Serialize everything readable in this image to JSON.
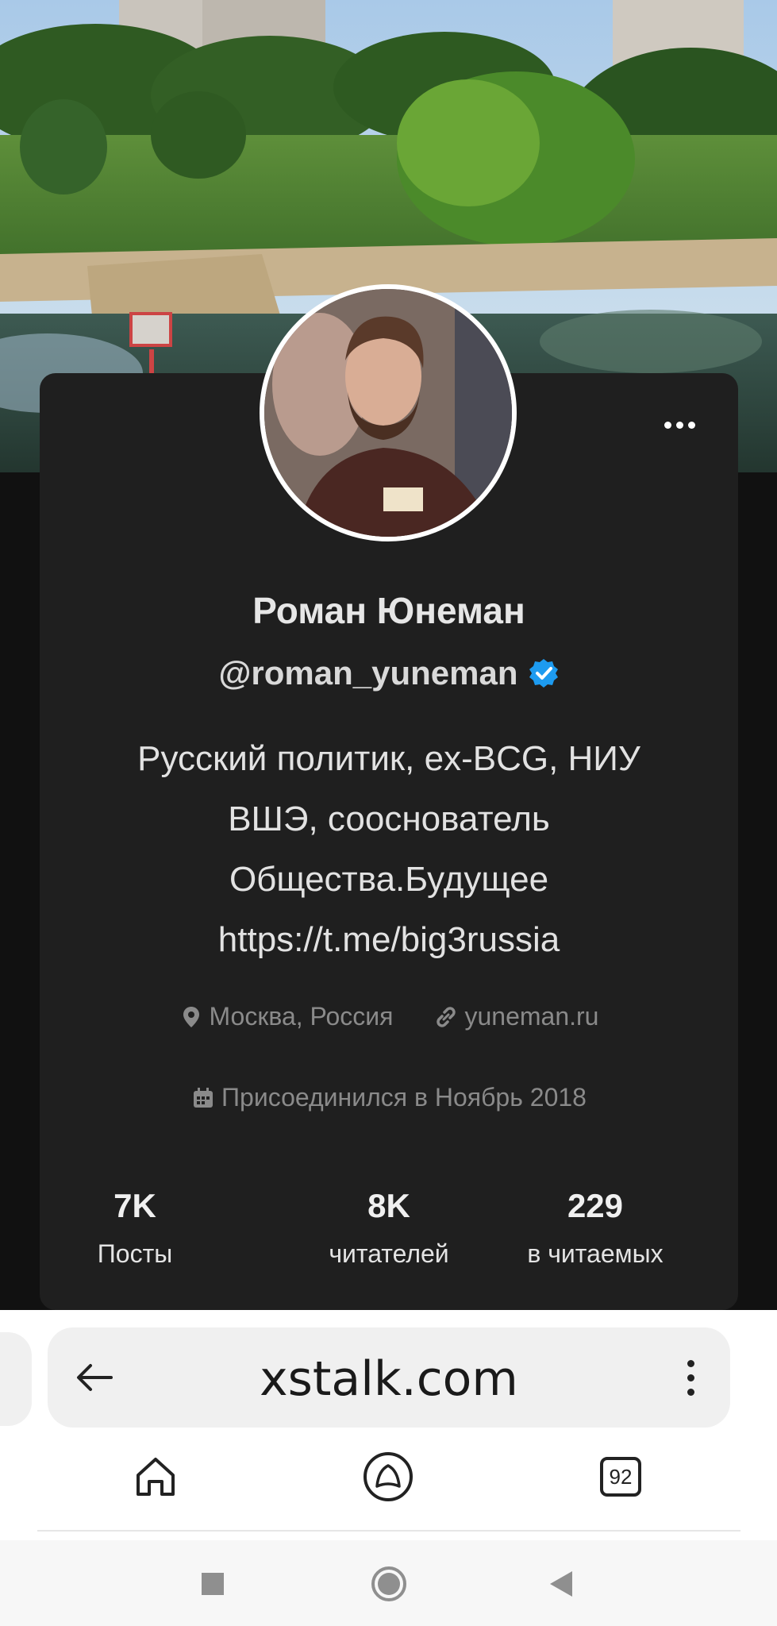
{
  "profile": {
    "name": "Роман Юнеман",
    "handle": "@roman_yuneman",
    "verified": true,
    "bio_lines": [
      "Русский политик, ex-BCG, НИУ",
      "ВШЭ, сооснователь",
      "Общества.Будущее",
      "https://t.me/big3russia"
    ],
    "location": "Москва, Россия",
    "website": "yuneman.ru",
    "joined": "Присоединился в Ноябрь 2018"
  },
  "stats": [
    {
      "value": "7K",
      "label": "Посты"
    },
    {
      "value": "8K",
      "label": "читателей"
    },
    {
      "value": "229",
      "label": "в читаемых"
    }
  ],
  "browser": {
    "url": "xstalk.com",
    "tabs_count": "92"
  },
  "colors": {
    "card_bg": "#1f1f1f",
    "verified_blue": "#1d9bf0",
    "muted_text": "#8a8a8a"
  },
  "icons": {
    "more": "more-horizontal-icon",
    "verified": "verified-badge-icon",
    "location": "map-pin-icon",
    "link": "link-icon",
    "calendar": "calendar-icon",
    "back": "arrow-left-icon",
    "browser_menu": "more-vertical-icon",
    "home": "home-icon",
    "alice": "alice-assistant-icon",
    "tabs": "tabs-icon",
    "sys_recent": "square-icon",
    "sys_home": "circle-icon",
    "sys_back": "triangle-back-icon"
  }
}
